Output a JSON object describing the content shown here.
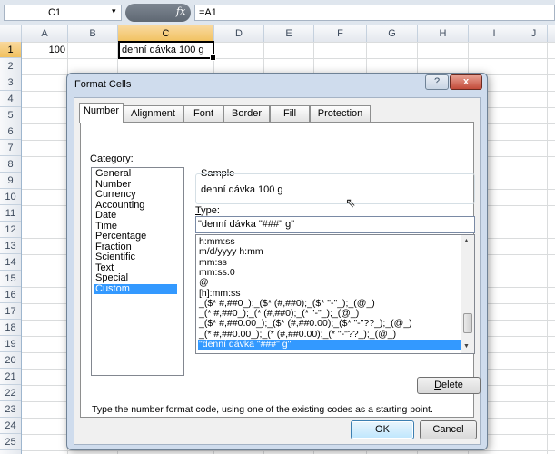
{
  "formula_bar": {
    "name_box": "C1",
    "name_box_arrow": "▾",
    "fx": "fx",
    "formula": "=A1"
  },
  "sheet": {
    "columns": [
      "A",
      "B",
      "C",
      "D",
      "E",
      "F",
      "G",
      "H",
      "I",
      "J"
    ],
    "selected_column": "C",
    "rows": [
      "1",
      "2",
      "3",
      "4",
      "5",
      "6",
      "7",
      "8",
      "9",
      "10",
      "11",
      "12",
      "13",
      "14",
      "15",
      "16",
      "17",
      "18",
      "19",
      "20",
      "21",
      "22",
      "23",
      "24",
      "25"
    ],
    "selected_row": "1",
    "cell_a1": "100",
    "cell_c1": "denní dávka 100 g"
  },
  "dialog": {
    "title": "Format Cells",
    "help": "?",
    "close": "x",
    "tabs": [
      "Number",
      "Alignment",
      "Font",
      "Border",
      "Fill",
      "Protection"
    ],
    "active_tab": "Number",
    "category_label_u": "C",
    "category_label_rest": "ategory:",
    "categories": [
      "General",
      "Number",
      "Currency",
      "Accounting",
      "Date",
      "Time",
      "Percentage",
      "Fraction",
      "Scientific",
      "Text",
      "Special",
      "Custom"
    ],
    "selected_category": "Custom",
    "sample_label": "Sample",
    "sample_value": "denní dávka 100 g",
    "type_label_u": "T",
    "type_label_rest": "ype:",
    "type_value": "\"denní dávka \"###\" g\"",
    "formats": [
      "h:mm:ss",
      "m/d/yyyy h:mm",
      "mm:ss",
      "mm:ss.0",
      "@",
      "[h]:mm:ss",
      "_($* #,##0_);_($* (#,##0);_($* \"-\"_);_(@_)",
      "_(* #,##0_);_(* (#,##0);_(* \"-\"_);_(@_)",
      "_($* #,##0.00_);_($* (#,##0.00);_($* \"-\"??_);_(@_)",
      "_(* #,##0.00_);_(* (#,##0.00);_(* \"-\"??_);_(@_)",
      "\"denní dávka \"###\" g\""
    ],
    "selected_format_index": 10,
    "scroll_up": "▲",
    "scroll_down": "▼",
    "delete_u": "D",
    "delete_rest": "elete",
    "hint": "Type the number format code, using one of the existing codes as a starting point.",
    "ok": "OK",
    "cancel": "Cancel"
  }
}
